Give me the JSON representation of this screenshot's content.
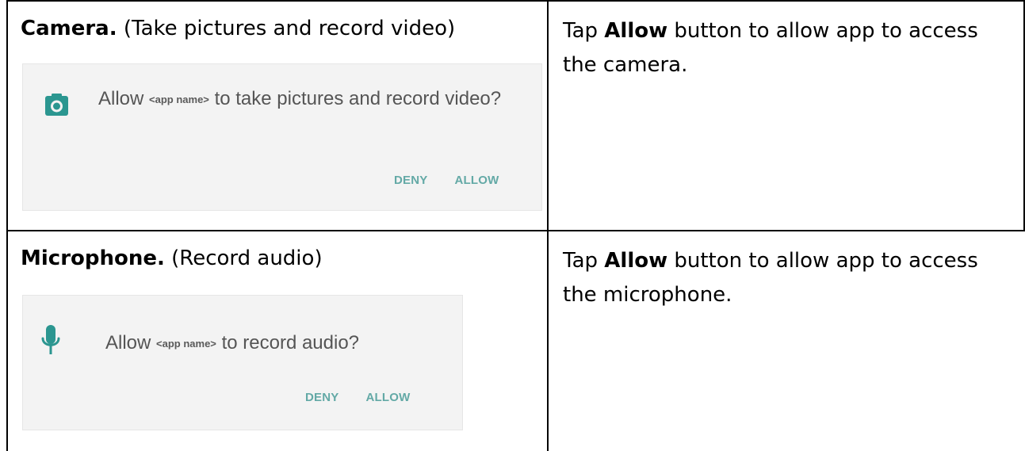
{
  "rows": [
    {
      "heading": {
        "title": "Camera.",
        "description": "(Take pictures and record video)"
      },
      "dialog": {
        "prompt_before": "Allow",
        "app_name": "<app name>",
        "prompt_after": "to take pictures and record video?",
        "deny_label": "DENY",
        "allow_label": "ALLOW",
        "icon": "camera-icon"
      },
      "instruction": {
        "before": "Tap",
        "emphasis": "Allow",
        "after": "button to allow app to access the camera."
      }
    },
    {
      "heading": {
        "title": "Microphone.",
        "description": "(Record audio)"
      },
      "dialog": {
        "prompt_before": "Allow",
        "app_name": "<app name>",
        "prompt_after": "to record audio?",
        "deny_label": "DENY",
        "allow_label": "ALLOW",
        "icon": "microphone-icon"
      },
      "instruction": {
        "before": "Tap",
        "emphasis": "Allow",
        "after": "button to allow app to access the microphone."
      }
    }
  ],
  "colors": {
    "icon": "#2b9690",
    "action": "#63a9a6",
    "dialog_background": "#f3f3f3",
    "border": "#000000"
  }
}
